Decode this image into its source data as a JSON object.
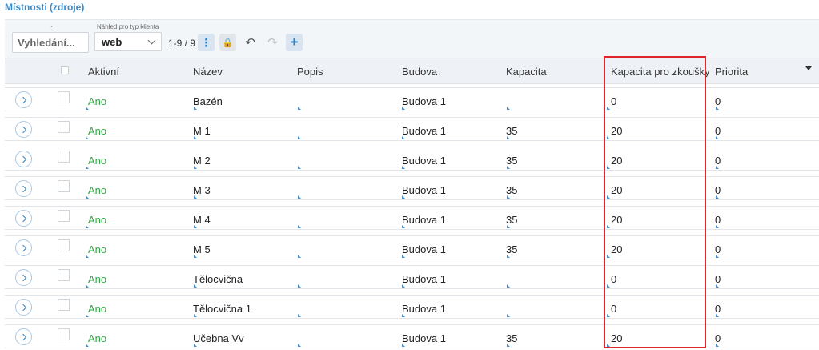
{
  "page": {
    "title": "Místnosti (zdroje)"
  },
  "toolbar": {
    "search_caption": ".",
    "search_placeholder": "Vyhledání...",
    "view_caption": "Náhled pro typ klienta",
    "view_value": "web",
    "pager_text": "1-9 / 9",
    "menu_icon": "⋮",
    "lock_icon": "🔒",
    "undo_icon": "↶",
    "redo_icon": "↷",
    "add_icon": "+"
  },
  "columns": {
    "active": "Aktivní",
    "name": "Název",
    "description": "Popis",
    "building": "Budova",
    "capacity": "Kapacita",
    "exam_capacity": "Kapacita pro zkoušky",
    "priority": "Priorita"
  },
  "rows": [
    {
      "active": "Ano",
      "name": "Bazén",
      "description": "",
      "building": "Budova 1",
      "capacity": "",
      "exam_capacity": "0",
      "priority": "0"
    },
    {
      "active": "Ano",
      "name": "M 1",
      "description": "",
      "building": "Budova 1",
      "capacity": "35",
      "exam_capacity": "20",
      "priority": "0"
    },
    {
      "active": "Ano",
      "name": "M 2",
      "description": "",
      "building": "Budova 1",
      "capacity": "35",
      "exam_capacity": "20",
      "priority": "0"
    },
    {
      "active": "Ano",
      "name": "M 3",
      "description": "",
      "building": "Budova 1",
      "capacity": "35",
      "exam_capacity": "20",
      "priority": "0"
    },
    {
      "active": "Ano",
      "name": "M 4",
      "description": "",
      "building": "Budova 1",
      "capacity": "35",
      "exam_capacity": "20",
      "priority": "0"
    },
    {
      "active": "Ano",
      "name": "M 5",
      "description": "",
      "building": "Budova 1",
      "capacity": "35",
      "exam_capacity": "20",
      "priority": "0"
    },
    {
      "active": "Ano",
      "name": "Tělocvična",
      "description": "",
      "building": "Budova 1",
      "capacity": "",
      "exam_capacity": "0",
      "priority": "0"
    },
    {
      "active": "Ano",
      "name": "Tělocvična 1",
      "description": "",
      "building": "Budova 1",
      "capacity": "",
      "exam_capacity": "0",
      "priority": "0"
    },
    {
      "active": "Ano",
      "name": "Učebna Vv",
      "description": "",
      "building": "Budova 1",
      "capacity": "35",
      "exam_capacity": "20",
      "priority": "0"
    }
  ],
  "colors": {
    "accent": "#2f7fc1",
    "active_green": "#2fa843",
    "highlight_red": "#e0262a"
  }
}
